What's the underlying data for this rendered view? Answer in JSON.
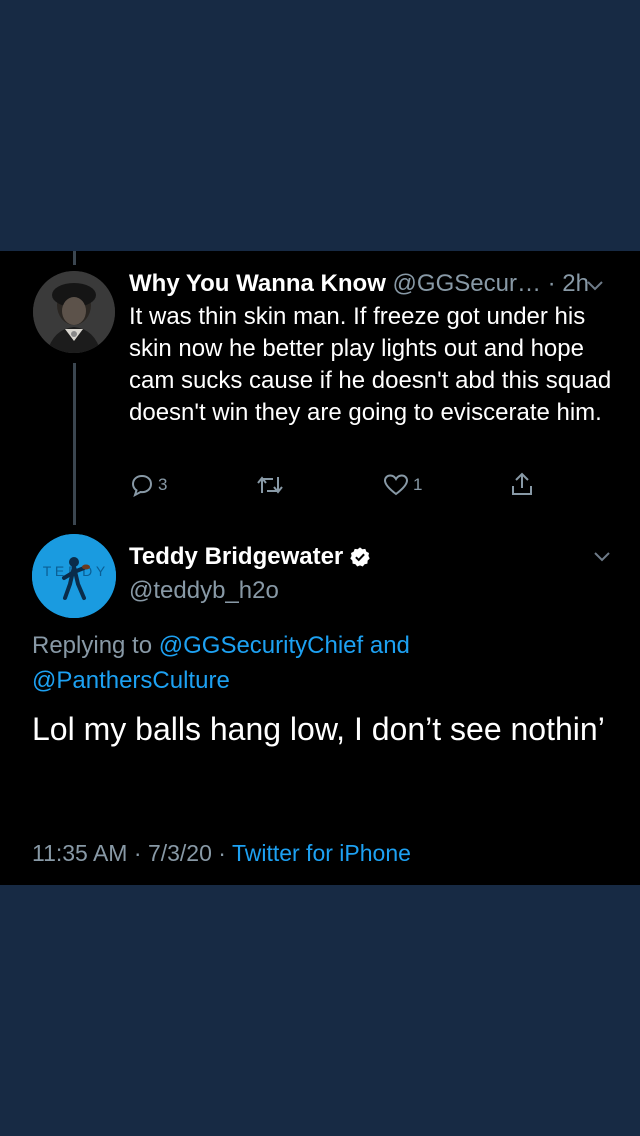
{
  "colors": {
    "page_bg": "#172a44",
    "card_bg": "#000000",
    "link": "#1da1f2",
    "muted": "#8899a6",
    "text": "#ffffff"
  },
  "parent_tweet": {
    "name": "Why You Wanna Know",
    "handle": "@GGSecur…",
    "separator": "·",
    "time": "2h",
    "text": "It was thin skin man. If freeze got under his skin now he better play lights out and hope cam sucks cause if he doesn't abd this squad doesn't win they are going to eviscerate him.",
    "actions": {
      "reply_count": "3",
      "retweet_count": "",
      "like_count": "1"
    },
    "avatar_icon": "portrait-avatar"
  },
  "main_tweet": {
    "name": "Teddy Bridgewater",
    "verified": true,
    "handle": "@teddyb_h2o",
    "replying_prefix": "Replying to",
    "replying_user_1": "@GGSecurityChief",
    "replying_and": "and",
    "replying_user_2": "@PanthersCulture",
    "text": "Lol my balls hang low, I don’t see nothin’",
    "time": "11:35 AM",
    "sep1": "·",
    "date": "7/3/20",
    "sep2": "·",
    "source": "Twitter for iPhone",
    "avatar_icon": "player-avatar"
  }
}
